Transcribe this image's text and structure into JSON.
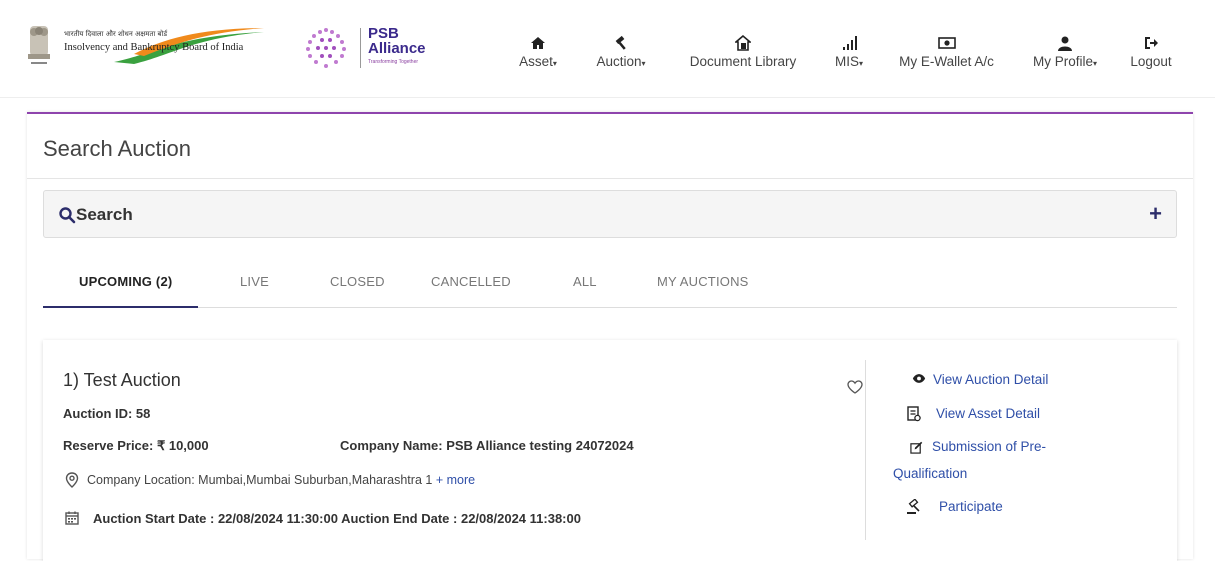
{
  "brand": {
    "ibbi_hindi": "भारतीय दिवाला और शोधन अक्षमता बोर्ड",
    "ibbi_name": "Insolvency and Bankruptcy Board of India",
    "psb_line1": "PSB",
    "psb_line2": "Alliance",
    "psb_tagline": "Transforming Together"
  },
  "nav": [
    {
      "label": "Asset",
      "icon": "home-icon",
      "dropdown": true
    },
    {
      "label": "Auction",
      "icon": "gavel-icon",
      "dropdown": true
    },
    {
      "label": "Document Library",
      "icon": "document-house-icon",
      "dropdown": false
    },
    {
      "label": "MIS",
      "icon": "signal-bars-icon",
      "dropdown": true
    },
    {
      "label": "My E-Wallet A/c",
      "icon": "money-icon",
      "dropdown": false
    },
    {
      "label": "My Profile",
      "icon": "user-icon",
      "dropdown": true
    },
    {
      "label": "Logout",
      "icon": "logout-icon",
      "dropdown": false
    }
  ],
  "page": {
    "title": "Search Auction",
    "search_label": "Search",
    "expand_symbol": "+"
  },
  "tabs": [
    {
      "label": "UPCOMING (2)",
      "active": true
    },
    {
      "label": "LIVE",
      "active": false
    },
    {
      "label": "CLOSED",
      "active": false
    },
    {
      "label": "CANCELLED",
      "active": false
    },
    {
      "label": "ALL",
      "active": false
    },
    {
      "label": "MY AUCTIONS",
      "active": false
    }
  ],
  "auction": {
    "title": "1) Test Auction",
    "id_line": "Auction ID: 58",
    "reserve_line": "Reserve Price: ₹ 10,000",
    "company_line": "Company Name: PSB Alliance testing 24072024",
    "location_line": "Company Location: Mumbai,Mumbai Suburban,Maharashtra 1",
    "more_link": "+ more",
    "dates_line": "Auction Start Date : 22/08/2024 11:30:00   Auction End Date : 22/08/2024 11:38:00"
  },
  "actions": {
    "view_auction": "View Auction Detail",
    "view_asset": "View Asset Detail",
    "prequal_1": "Submission of Pre-",
    "prequal_2": "Qualification",
    "participate": "Participate"
  },
  "colors": {
    "accent_purple": "#8e44ad",
    "navy": "#2c2d6b",
    "link_blue": "#2f4fa8"
  }
}
